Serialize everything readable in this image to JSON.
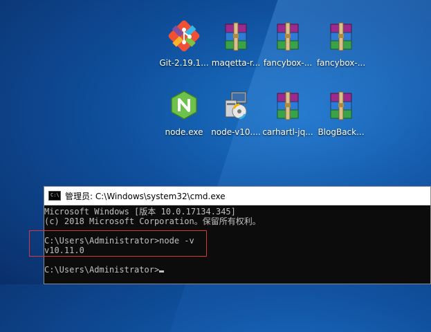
{
  "desktop": {
    "icons": [
      {
        "label": "Git-2.19.1..."
      },
      {
        "label": "maqetta-r..."
      },
      {
        "label": "fancybox-..."
      },
      {
        "label": "fancybox-..."
      },
      {
        "label": "node.exe"
      },
      {
        "label": "node-v10...."
      },
      {
        "label": "carhartl-jq..."
      },
      {
        "label": "BlogBack..."
      }
    ]
  },
  "cmd_window": {
    "title": "管理员: C:\\Windows\\system32\\cmd.exe",
    "icon_text": "C:\\",
    "lines": [
      "Microsoft Windows [版本 10.0.17134.345]",
      "(c) 2018 Microsoft Corporation。保留所有权利。",
      "",
      "C:\\Users\\Administrator>node -v",
      "v10.11.0",
      "",
      "C:\\Users\\Administrator>"
    ]
  },
  "colors": {
    "highlight_border": "#e03535",
    "console_bg": "#0c0c0c",
    "console_text": "#c0c0c0"
  }
}
